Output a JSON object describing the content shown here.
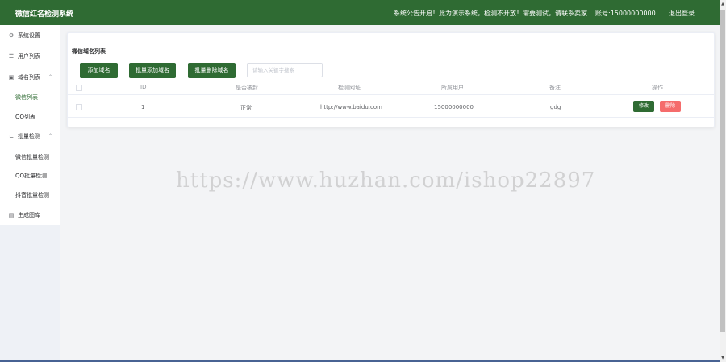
{
  "header": {
    "brand": "微信红名检测系统",
    "notice": "系统公告开启！此为演示系统，检测不开放！需要测试，请联系卖家",
    "account": "账号:15000000000",
    "logout": "退出登录"
  },
  "sidebar": {
    "items": [
      {
        "label": "系统设置",
        "icon": "gear-icon",
        "glyph": "⚙"
      },
      {
        "label": "用户列表",
        "icon": "user-list-icon",
        "glyph": "☰"
      },
      {
        "label": "域名列表",
        "icon": "domain-icon",
        "glyph": "▣",
        "arrow": "⌃"
      },
      {
        "label": "微信列表",
        "sub": true,
        "active": true
      },
      {
        "label": "QQ列表",
        "sub": true
      },
      {
        "label": "批量检测",
        "icon": "check-icon",
        "glyph": "⊏",
        "arrow": "⌃"
      },
      {
        "label": "微信批量检测",
        "sub": true
      },
      {
        "label": "QQ批量检测",
        "sub": true
      },
      {
        "label": "抖音批量检测",
        "sub": true
      },
      {
        "label": "生成图库",
        "icon": "image-icon",
        "glyph": "▤"
      }
    ]
  },
  "panel": {
    "title": "微信域名列表",
    "buttons": {
      "add": "添加域名",
      "batch_add": "批量添加域名",
      "batch_delete": "批量删除域名"
    },
    "search_placeholder": "请输入关键字搜索"
  },
  "table": {
    "headers": [
      "ID",
      "是否被封",
      "检测网址",
      "所属用户",
      "备注",
      "操作"
    ],
    "rows": [
      {
        "id": "1",
        "status": "正常",
        "url": "http://www.baidu.com",
        "user": "15000000000",
        "remark": "gdg",
        "edit": "修改",
        "delete": "删除"
      }
    ]
  },
  "watermark": "https://www.huzhan.com/ishop22897",
  "colors": {
    "primary": "#2f6b33",
    "danger": "#f56c6c",
    "sidebar_bottom": "#eef1f6"
  }
}
